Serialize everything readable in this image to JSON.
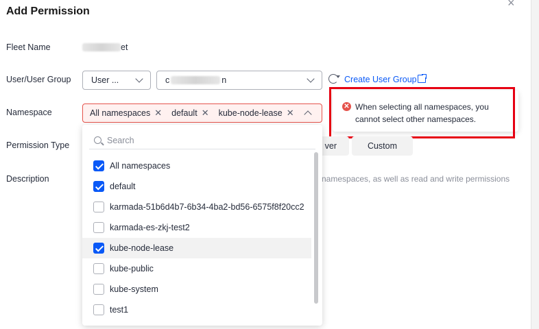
{
  "dialog": {
    "title": "Add Permission",
    "close_glyph": "×"
  },
  "form": {
    "fleet_name_label": "Fleet Name",
    "fleet_name_value_suffix": "et",
    "user_group_label": "User/User Group",
    "user_type_value": "User ...",
    "user_select_prefix": "c",
    "user_select_suffix": "n",
    "create_user_group": "Create User Group",
    "namespace_label": "Namespace",
    "namespace_tags": [
      "All namespaces",
      "default",
      "kube-node-lease"
    ],
    "permission_type_label": "Permission Type",
    "permission_buttons": [
      "ver",
      "Custom"
    ],
    "description_label": "Description",
    "description_text": "namespaces, as well as read and write permissions"
  },
  "error": {
    "icon": "error-icon",
    "message": "When selecting all namespaces, you cannot select other namespaces.",
    "color": "#e5524b"
  },
  "dropdown": {
    "search_placeholder": "Search",
    "options": [
      {
        "label": "All namespaces",
        "checked": true
      },
      {
        "label": "default",
        "checked": true
      },
      {
        "label": "karmada-51b6d4b7-6b34-4ba2-bd56-6575f8f20cc2",
        "checked": false
      },
      {
        "label": "karmada-es-zkj-test2",
        "checked": false
      },
      {
        "label": "kube-node-lease",
        "checked": true
      },
      {
        "label": "kube-public",
        "checked": false
      },
      {
        "label": "kube-system",
        "checked": false
      },
      {
        "label": "test1",
        "checked": false
      }
    ]
  },
  "colors": {
    "accent": "#0a59f7",
    "error_border": "#e60012"
  }
}
